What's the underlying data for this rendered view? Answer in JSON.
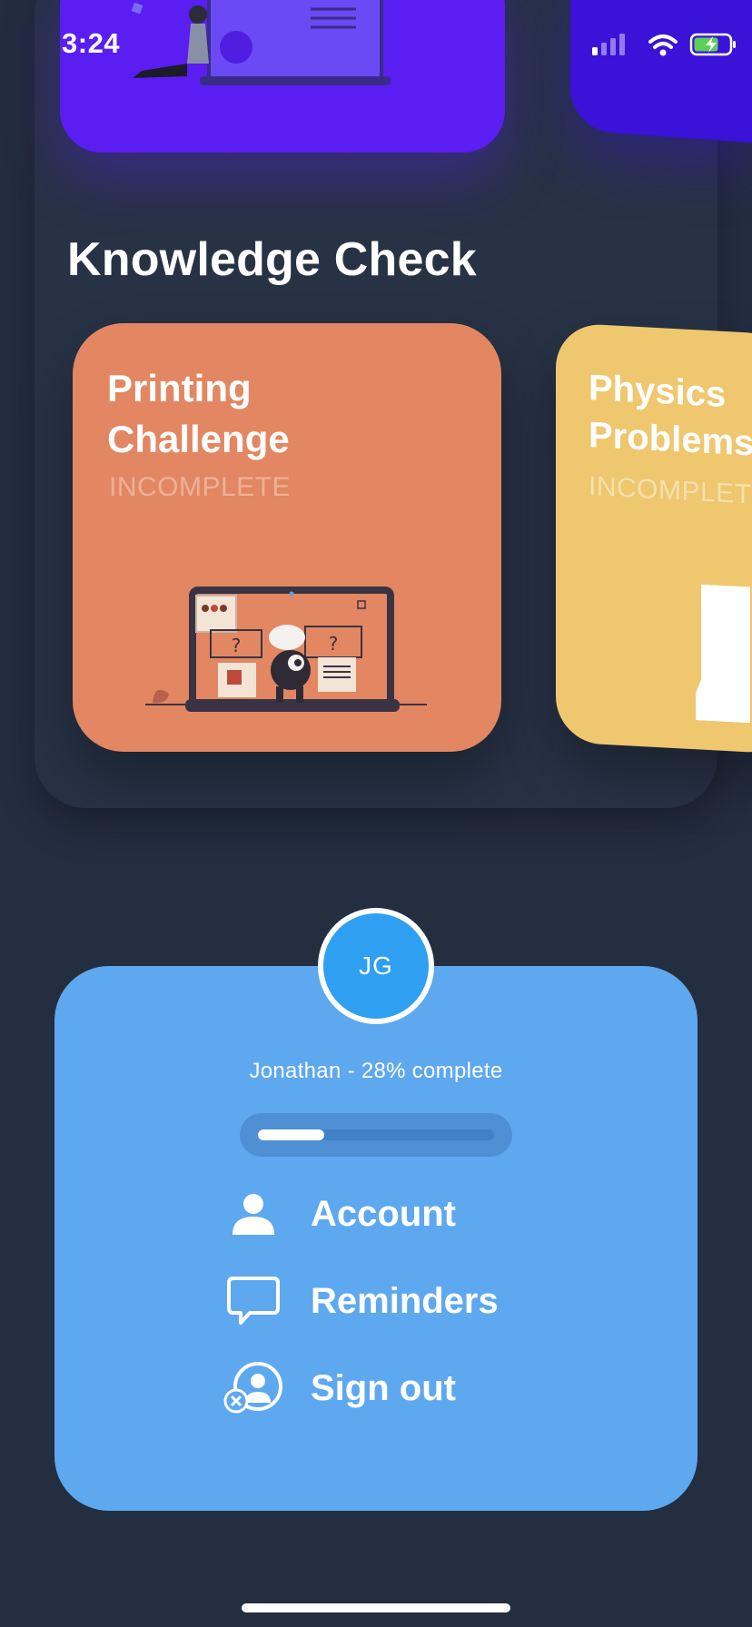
{
  "status_bar": {
    "time": "3:24"
  },
  "section": {
    "title": "Knowledge Check"
  },
  "cards": [
    {
      "title": "Printing Challenge",
      "status": "INCOMPLETE",
      "color": "#e28762"
    },
    {
      "title": "Physics Problems",
      "status": "INCOMPLETE",
      "color": "#eec76e"
    }
  ],
  "profile": {
    "initials": "JG",
    "progress_text": "Jonathan - 28% complete",
    "progress_fraction": 0.28
  },
  "menu": {
    "items": [
      {
        "label": "Account",
        "icon": "person-icon"
      },
      {
        "label": "Reminders",
        "icon": "chat-bubble-icon"
      },
      {
        "label": "Sign out",
        "icon": "sign-out-user-icon"
      }
    ]
  },
  "colors": {
    "background": "#242e41",
    "menu_panel": "#5ea8ef",
    "avatar": "#2f9ff1",
    "top_card": "#5a1df2"
  }
}
